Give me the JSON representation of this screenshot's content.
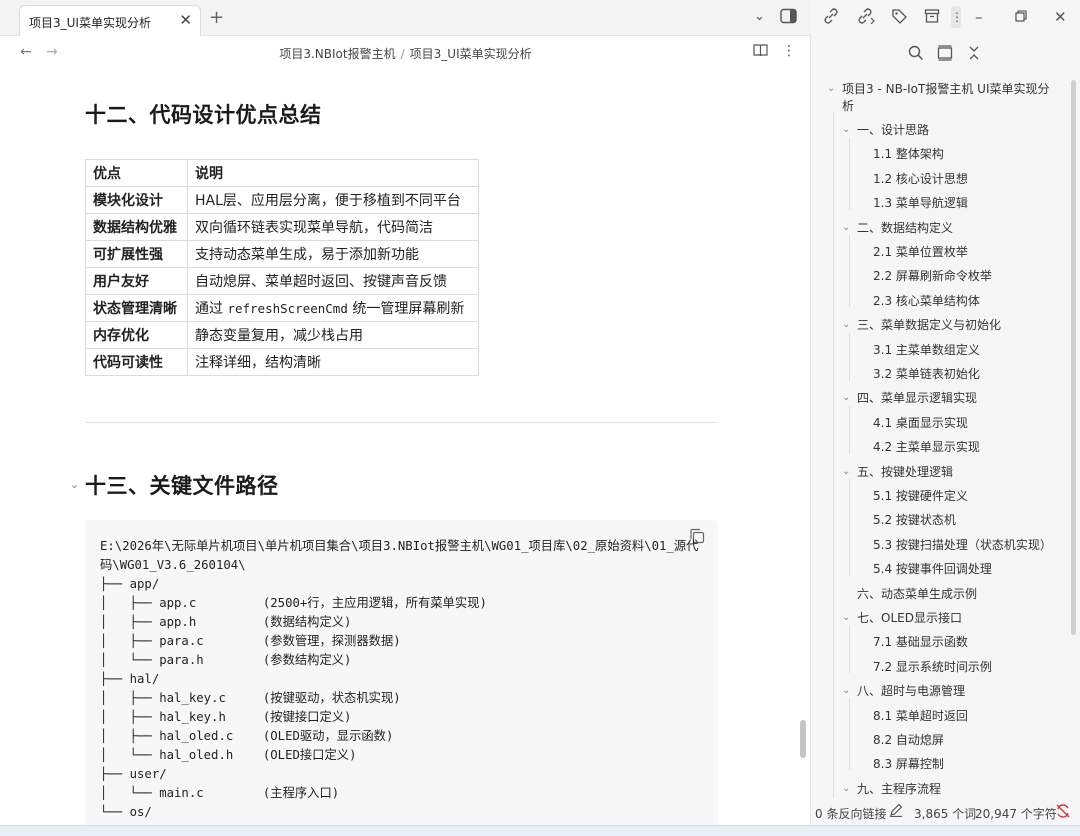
{
  "tab": {
    "title": "项目3_UI菜单实现分析",
    "close": "✕",
    "add": "+"
  },
  "breadcrumb": {
    "folder": "项目3.NBIot报警主机",
    "sep": "/",
    "file": "项目3_UI菜单实现分析"
  },
  "section12": {
    "title": "十二、代码设计优点总结"
  },
  "table": {
    "headers": [
      "优点",
      "说明"
    ],
    "rows": [
      {
        "k": "模块化设计",
        "v": "HAL层、应用层分离，便于移植到不同平台"
      },
      {
        "k": "数据结构优雅",
        "v": "双向循环链表实现菜单导航，代码简洁"
      },
      {
        "k": "可扩展性强",
        "v": "支持动态菜单生成，易于添加新功能"
      },
      {
        "k": "用户友好",
        "v": "自动熄屏、菜单超时返回、按键声音反馈"
      },
      {
        "k": "状态管理清晰",
        "v_pre": "通过 ",
        "v_code": "refreshScreenCmd",
        "v_post": " 统一管理屏幕刷新"
      },
      {
        "k": "内存优化",
        "v": "静态变量复用，减少栈占用"
      },
      {
        "k": "代码可读性",
        "v": "注释详细，结构清晰"
      }
    ]
  },
  "section13": {
    "title": "十三、关键文件路径"
  },
  "code": {
    "path_line1": "E:\\2026年\\无际单片机项目\\单片机项目集合\\项目3.NBIot报警主机\\WG01_项目库\\02_原始资料\\01_源代",
    "path_line2": "码\\WG01_V3.6_260104\\",
    "lines": [
      "├── app/",
      "│   ├── app.c         (2500+行，主应用逻辑，所有菜单实现)",
      "│   ├── app.h         (数据结构定义)",
      "│   ├── para.c        (参数管理，探测器数据)",
      "│   └── para.h        (参数结构定义)",
      "├── hal/",
      "│   ├── hal_key.c     (按键驱动，状态机实现)",
      "│   ├── hal_key.h     (按键接口定义)",
      "│   ├── hal_oled.c    (OLED驱动，显示函数)",
      "│   └── hal_oled.h    (OLED接口定义)",
      "├── user/",
      "│   └── main.c        (主程序入口)",
      "└── os/"
    ]
  },
  "outline": {
    "items": [
      {
        "text": "项目3 - NB-IoT报警主机 UI菜单实现分",
        "level": 0,
        "chev": true
      },
      {
        "text": "析",
        "level": 0,
        "cont": true
      },
      {
        "text": "一、设计思路",
        "level": 1,
        "chev": true
      },
      {
        "text": "1.1 整体架构",
        "level": 2
      },
      {
        "text": "1.2 核心设计思想",
        "level": 2
      },
      {
        "text": "1.3 菜单导航逻辑",
        "level": 2
      },
      {
        "text": "二、数据结构定义",
        "level": 1,
        "chev": true
      },
      {
        "text": "2.1 菜单位置枚举",
        "level": 2
      },
      {
        "text": "2.2 屏幕刷新命令枚举",
        "level": 2
      },
      {
        "text": "2.3 核心菜单结构体",
        "level": 2
      },
      {
        "text": "三、菜单数据定义与初始化",
        "level": 1,
        "chev": true
      },
      {
        "text": "3.1 主菜单数组定义",
        "level": 2
      },
      {
        "text": "3.2 菜单链表初始化",
        "level": 2
      },
      {
        "text": "四、菜单显示逻辑实现",
        "level": 1,
        "chev": true
      },
      {
        "text": "4.1 桌面显示实现",
        "level": 2
      },
      {
        "text": "4.2 主菜单显示实现",
        "level": 2
      },
      {
        "text": "五、按键处理逻辑",
        "level": 1,
        "chev": true
      },
      {
        "text": "5.1 按键硬件定义",
        "level": 2
      },
      {
        "text": "5.2 按键状态机",
        "level": 2
      },
      {
        "text": "5.3 按键扫描处理（状态机实现）",
        "level": 2
      },
      {
        "text": "5.4 按键事件回调处理",
        "level": 2
      },
      {
        "text": "六、动态菜单生成示例",
        "level": 1
      },
      {
        "text": "七、OLED显示接口",
        "level": 1,
        "chev": true
      },
      {
        "text": "7.1 基础显示函数",
        "level": 2
      },
      {
        "text": "7.2 显示系统时间示例",
        "level": 2
      },
      {
        "text": "八、超时与电源管理",
        "level": 1,
        "chev": true
      },
      {
        "text": "8.1 菜单超时返回",
        "level": 2
      },
      {
        "text": "8.2 自动熄屏",
        "level": 2
      },
      {
        "text": "8.3 屏幕控制",
        "level": 2
      },
      {
        "text": "九、主程序流程",
        "level": 1,
        "chev": true
      }
    ]
  },
  "status": {
    "backlinks": "0 条反向链接",
    "words": "3,865 个词",
    "chars": "20,947 个字符"
  },
  "icons": [
    "chevron-down-icon",
    "sidebar-toggle-icon",
    "back-arrow-icon",
    "forward-arrow-icon",
    "reading-view-icon",
    "more-options-icon",
    "copy-icon",
    "search-icon",
    "collapse-all-icon",
    "minimize-icon",
    "maximize-icon",
    "close-window-icon",
    "edit-icon",
    "sync-error-icon"
  ]
}
